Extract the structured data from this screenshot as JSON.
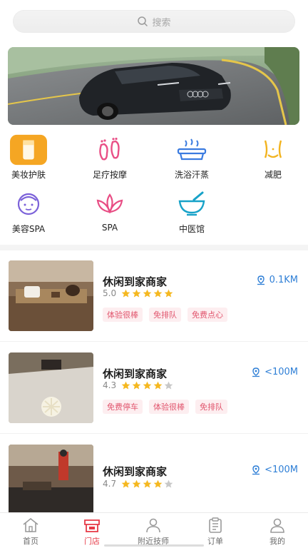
{
  "search": {
    "placeholder": "搜索"
  },
  "categories": [
    {
      "label": "美妆护肤",
      "icon": "cosmetics-icon"
    },
    {
      "label": "足疗按摩",
      "icon": "foot-massage-icon"
    },
    {
      "label": "洗浴汗蒸",
      "icon": "bath-icon"
    },
    {
      "label": "减肥",
      "icon": "slimming-icon"
    },
    {
      "label": "美容SPA",
      "icon": "face-spa-icon"
    },
    {
      "label": "SPA",
      "icon": "lotus-icon"
    },
    {
      "label": "中医馆",
      "icon": "mortar-icon"
    }
  ],
  "shops": [
    {
      "name": "休闲到家商家",
      "score": "5.0",
      "stars": 5,
      "distance": "0.1KM",
      "tags": [
        "体验很棒",
        "免排队",
        "免费点心"
      ]
    },
    {
      "name": "休闲到家商家",
      "score": "4.3",
      "stars": 4,
      "distance": "<100M",
      "tags": [
        "免费停车",
        "体验很棒",
        "免排队"
      ]
    },
    {
      "name": "休闲到家商家",
      "score": "4.7",
      "stars": 4,
      "distance": "<100M",
      "tags": []
    }
  ],
  "tabs": [
    {
      "label": "首页",
      "icon": "home-icon"
    },
    {
      "label": "门店",
      "icon": "store-icon",
      "active": true
    },
    {
      "label": "附近技师",
      "icon": "technician-icon"
    },
    {
      "label": "订单",
      "icon": "order-icon"
    },
    {
      "label": "我的",
      "icon": "profile-icon"
    }
  ],
  "colors": {
    "accent": "#e63946",
    "distance": "#2f7fd6",
    "star": "#f5b820",
    "tag_text": "#e1566e",
    "tag_bg": "#fdeef0"
  }
}
